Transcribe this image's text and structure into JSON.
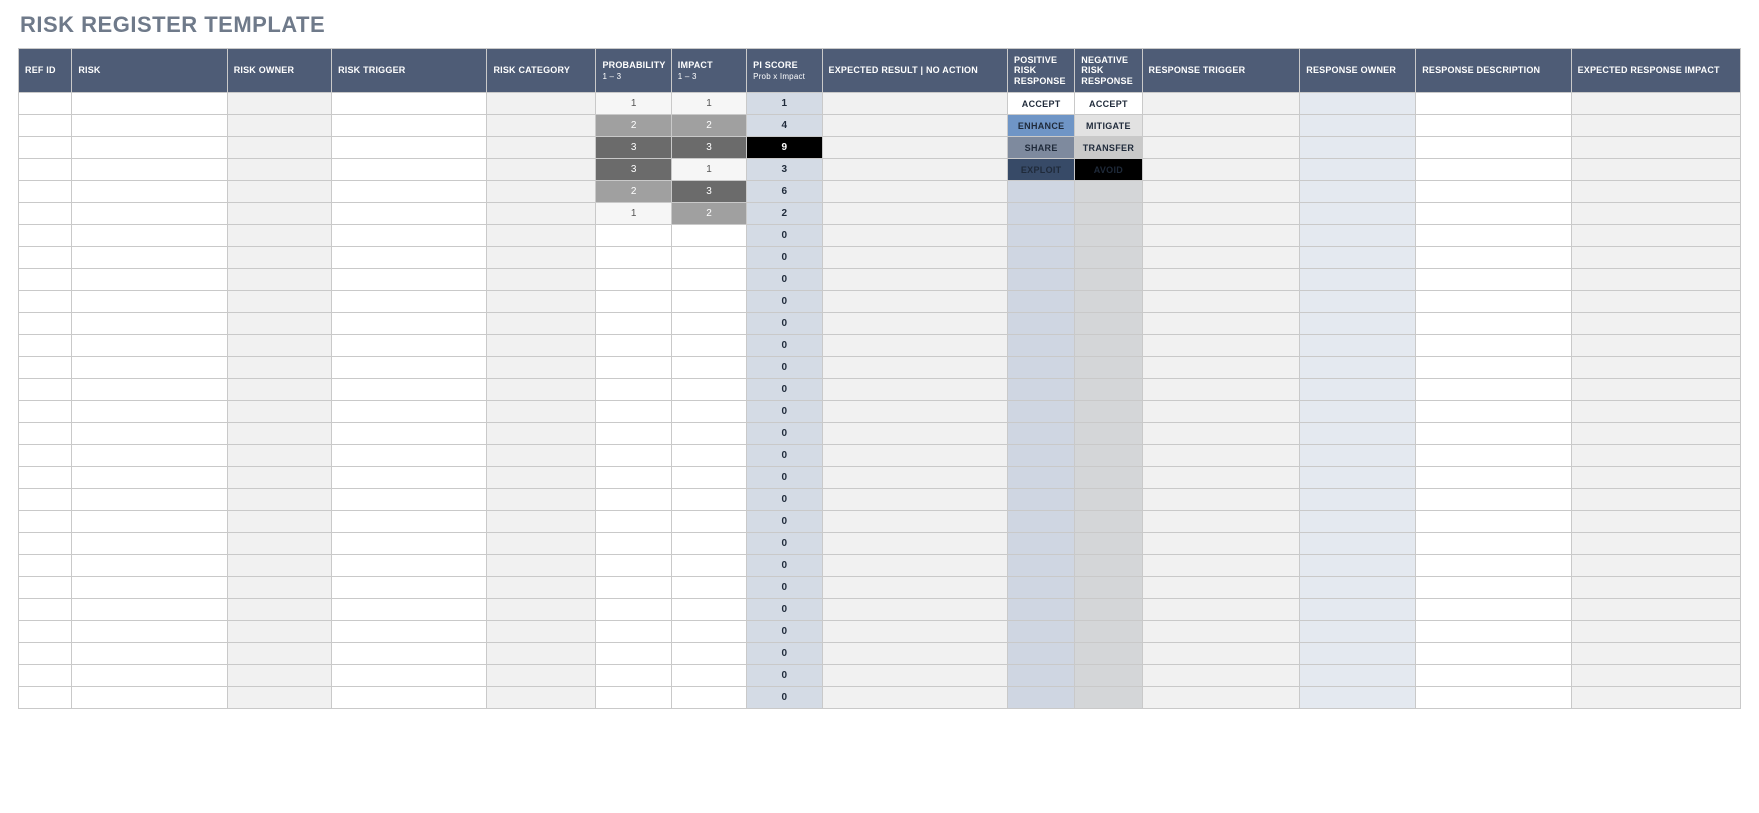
{
  "title": "RISK REGISTER TEMPLATE",
  "headers": {
    "ref_id": "REF ID",
    "risk": "RISK",
    "risk_owner": "RISK OWNER",
    "risk_trigger": "RISK TRIGGER",
    "risk_category": "RISK CATEGORY",
    "probability": "PROBABILITY",
    "probability_sub": "1 – 3",
    "impact": "IMPACT",
    "impact_sub": "1 – 3",
    "pi_score": "PI SCORE",
    "pi_score_sub": "Prob x Impact",
    "expected_result": "EXPECTED RESULT  |  NO ACTION",
    "positive_response": "POSITIVE RISK RESPONSE",
    "negative_response": "NEGATIVE RISK RESPONSE",
    "response_trigger": "RESPONSE TRIGGER",
    "response_owner": "RESPONSE OWNER",
    "response_description": "RESPONSE DESCRIPTION",
    "expected_response_impact": "EXPECTED RESPONSE IMPACT"
  },
  "rows": [
    {
      "probability": "1",
      "impact": "1",
      "pi": "1",
      "pos": "ACCEPT",
      "neg": "ACCEPT"
    },
    {
      "probability": "2",
      "impact": "2",
      "pi": "4",
      "pos": "ENHANCE",
      "neg": "MITIGATE"
    },
    {
      "probability": "3",
      "impact": "3",
      "pi": "9",
      "pos": "SHARE",
      "neg": "TRANSFER"
    },
    {
      "probability": "3",
      "impact": "1",
      "pi": "3",
      "pos": "EXPLOIT",
      "neg": "AVOID"
    },
    {
      "probability": "2",
      "impact": "3",
      "pi": "6",
      "pos": "",
      "neg": ""
    },
    {
      "probability": "1",
      "impact": "2",
      "pi": "2",
      "pos": "",
      "neg": ""
    },
    {
      "probability": "",
      "impact": "",
      "pi": "0",
      "pos": "",
      "neg": ""
    },
    {
      "probability": "",
      "impact": "",
      "pi": "0",
      "pos": "",
      "neg": ""
    },
    {
      "probability": "",
      "impact": "",
      "pi": "0",
      "pos": "",
      "neg": ""
    },
    {
      "probability": "",
      "impact": "",
      "pi": "0",
      "pos": "",
      "neg": ""
    },
    {
      "probability": "",
      "impact": "",
      "pi": "0",
      "pos": "",
      "neg": ""
    },
    {
      "probability": "",
      "impact": "",
      "pi": "0",
      "pos": "",
      "neg": ""
    },
    {
      "probability": "",
      "impact": "",
      "pi": "0",
      "pos": "",
      "neg": ""
    },
    {
      "probability": "",
      "impact": "",
      "pi": "0",
      "pos": "",
      "neg": ""
    },
    {
      "probability": "",
      "impact": "",
      "pi": "0",
      "pos": "",
      "neg": ""
    },
    {
      "probability": "",
      "impact": "",
      "pi": "0",
      "pos": "",
      "neg": ""
    },
    {
      "probability": "",
      "impact": "",
      "pi": "0",
      "pos": "",
      "neg": ""
    },
    {
      "probability": "",
      "impact": "",
      "pi": "0",
      "pos": "",
      "neg": ""
    },
    {
      "probability": "",
      "impact": "",
      "pi": "0",
      "pos": "",
      "neg": ""
    },
    {
      "probability": "",
      "impact": "",
      "pi": "0",
      "pos": "",
      "neg": ""
    },
    {
      "probability": "",
      "impact": "",
      "pi": "0",
      "pos": "",
      "neg": ""
    },
    {
      "probability": "",
      "impact": "",
      "pi": "0",
      "pos": "",
      "neg": ""
    },
    {
      "probability": "",
      "impact": "",
      "pi": "0",
      "pos": "",
      "neg": ""
    },
    {
      "probability": "",
      "impact": "",
      "pi": "0",
      "pos": "",
      "neg": ""
    },
    {
      "probability": "",
      "impact": "",
      "pi": "0",
      "pos": "",
      "neg": ""
    },
    {
      "probability": "",
      "impact": "",
      "pi": "0",
      "pos": "",
      "neg": ""
    },
    {
      "probability": "",
      "impact": "",
      "pi": "0",
      "pos": "",
      "neg": ""
    },
    {
      "probability": "",
      "impact": "",
      "pi": "0",
      "pos": "",
      "neg": ""
    }
  ],
  "chip_styles": {
    "ACCEPT_pos": "chip-accept",
    "ACCEPT_neg": "chip-accept",
    "ENHANCE": "chip-blue",
    "MITIGATE": "chip-ltgrey",
    "SHARE": "chip-steel",
    "TRANSFER": "chip-tgrey",
    "EXPLOIT": "chip-navy",
    "AVOID": "chip-black"
  }
}
